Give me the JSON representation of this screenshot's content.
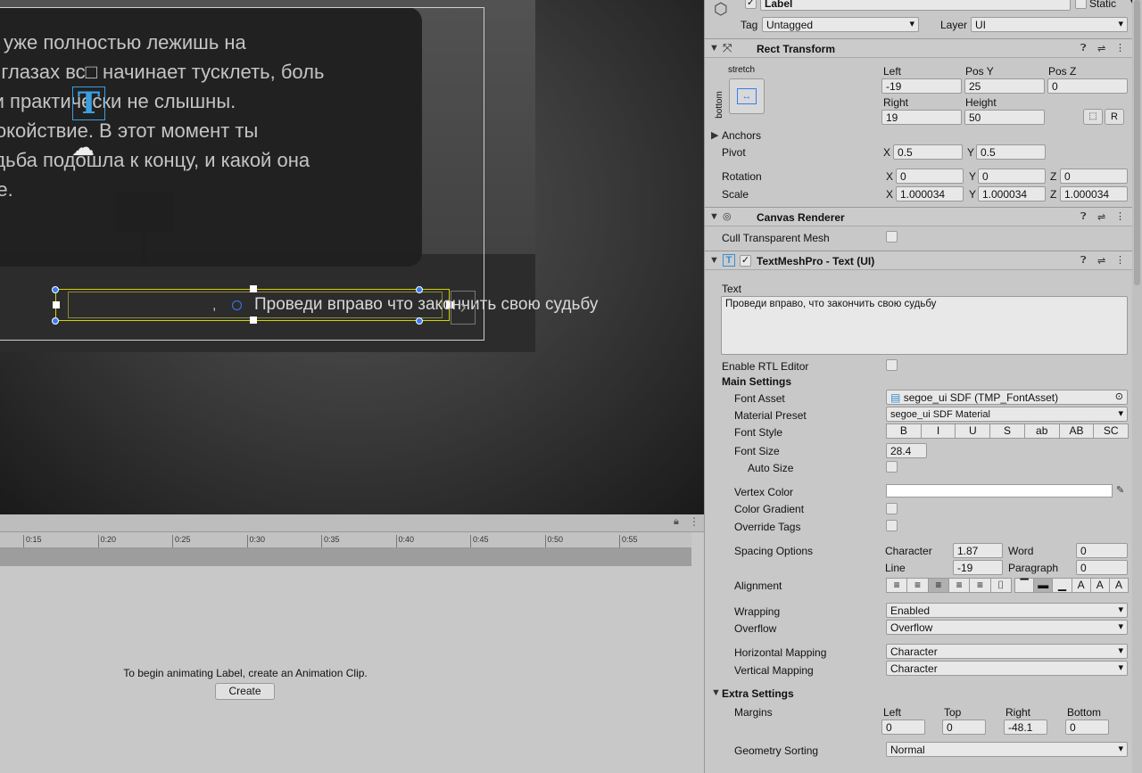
{
  "scene": {
    "dialog_lines": [
      "ты уже полностью лежишь на",
      "их глазах вс□ начинает тусклеть, боль",
      "уки практически не слышны.",
      "спокойствие. В этот момент ты",
      "судьба подошла к концу, и какой она",
      "ебе."
    ],
    "label_text": "Проведи вправо  что закончить свою судьбу",
    "comma": ","
  },
  "timeline": {
    "ticks": [
      "0:15",
      "0:20",
      "0:25",
      "0:30",
      "0:35",
      "0:40",
      "0:45",
      "0:50",
      "0:55"
    ],
    "message": "To begin animating Label, create an Animation Clip.",
    "create_button": "Create"
  },
  "inspector": {
    "object_name": "Label",
    "static_label": "Static",
    "tag_label": "Tag",
    "tag_value": "Untagged",
    "layer_label": "Layer",
    "layer_value": "UI",
    "rect_transform": {
      "title": "Rect Transform",
      "anchor_preset_top": "stretch",
      "anchor_preset_side": "bottom",
      "left_label": "Left",
      "left": "-19",
      "posy_label": "Pos Y",
      "posy": "25",
      "posz_label": "Pos Z",
      "posz": "0",
      "right_label": "Right",
      "right": "19",
      "height_label": "Height",
      "height": "50",
      "r_button": "R",
      "anchors_label": "Anchors",
      "pivot_label": "Pivot",
      "pivot_x": "0.5",
      "pivot_y": "0.5",
      "rotation_label": "Rotation",
      "rot_x": "0",
      "rot_y": "0",
      "rot_z": "0",
      "scale_label": "Scale",
      "scale_x": "1.000034",
      "scale_y": "1.000034",
      "scale_z": "1.000034",
      "x": "X",
      "y": "Y",
      "z": "Z"
    },
    "canvas_renderer": {
      "title": "Canvas Renderer",
      "cull_label": "Cull Transparent Mesh"
    },
    "tmp": {
      "title": "TextMeshPro - Text (UI)",
      "text_label": "Text",
      "text_value": "Проведи вправо, что закончить свою судьбу",
      "rtl_label": "Enable RTL Editor",
      "main_settings": "Main Settings",
      "font_asset_label": "Font Asset",
      "font_asset_value": "segoe_ui SDF (TMP_FontAsset)",
      "material_label": "Material Preset",
      "material_value": "segoe_ui SDF Material",
      "font_style_label": "Font Style",
      "font_styles": [
        "B",
        "I",
        "U",
        "S",
        "ab",
        "AB",
        "SC"
      ],
      "font_size_label": "Font Size",
      "font_size_value": "28.4",
      "auto_size_label": "Auto Size",
      "vertex_color_label": "Vertex Color",
      "color_gradient_label": "Color Gradient",
      "override_tags_label": "Override Tags",
      "spacing_label": "Spacing Options",
      "character_label": "Character",
      "character_value": "1.87",
      "word_label": "Word",
      "word_value": "0",
      "line_label": "Line",
      "line_value": "-19",
      "paragraph_label": "Paragraph",
      "paragraph_value": "0",
      "alignment_label": "Alignment",
      "wrapping_label": "Wrapping",
      "wrapping_value": "Enabled",
      "overflow_label": "Overflow",
      "overflow_value": "Overflow",
      "hmap_label": "Horizontal Mapping",
      "hmap_value": "Character",
      "vmap_label": "Vertical Mapping",
      "vmap_value": "Character",
      "extra_settings": "Extra Settings",
      "margins_label": "Margins",
      "m_left_label": "Left",
      "m_left": "0",
      "m_top_label": "Top",
      "m_top": "0",
      "m_right_label": "Right",
      "m_right": "-48.1",
      "m_bottom_label": "Bottom",
      "m_bottom": "0",
      "geometry_label": "Geometry Sorting",
      "geometry_value": "Normal"
    }
  },
  "colors": {
    "selection": "#d4d400",
    "handle": "#3b7bf0",
    "inspector_bg": "#c8c8c8"
  }
}
